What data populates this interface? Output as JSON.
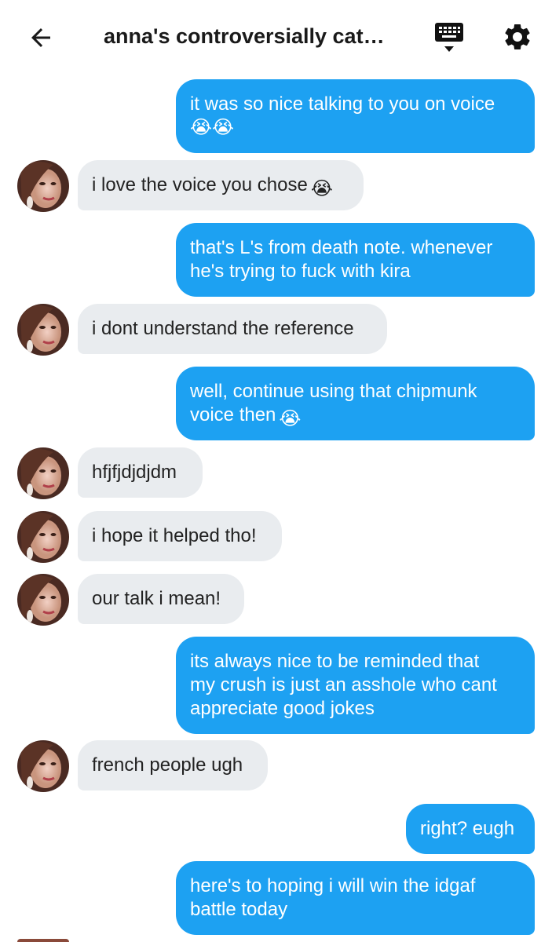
{
  "header": {
    "title": "anna's controversially cat…",
    "back_icon": "back-arrow-icon",
    "keyboard_icon": "keyboard-icon",
    "settings_icon": "gear-icon"
  },
  "colors": {
    "outgoing_bubble": "#1da1f2",
    "incoming_bubble": "#e9ecef",
    "outgoing_text": "#ffffff",
    "incoming_text": "#222222"
  },
  "messages": [
    {
      "side": "out",
      "lines": [
        "it was so nice talking to you on voice"
      ],
      "emoji_line": "😭😭"
    },
    {
      "side": "in",
      "lines": [
        "i love the voice you chose"
      ],
      "emoji": "😭"
    },
    {
      "side": "out",
      "lines": [
        "that's L's from death note. whenever",
        "he's trying to fuck with kira"
      ]
    },
    {
      "side": "in",
      "lines": [
        "i dont understand the reference"
      ]
    },
    {
      "side": "out",
      "lines": [
        "well, continue using that chipmunk",
        "voice then"
      ],
      "emoji": "😭"
    },
    {
      "side": "in",
      "lines": [
        "hfjfjdjdjdm"
      ]
    },
    {
      "side": "in",
      "lines": [
        "i hope it helped tho!"
      ]
    },
    {
      "side": "in",
      "lines": [
        "our talk i mean!"
      ]
    },
    {
      "side": "out",
      "lines": [
        "its always nice to be reminded that",
        "my crush is just an asshole who cant",
        "appreciate good jokes"
      ]
    },
    {
      "side": "in",
      "lines": [
        "french people ugh"
      ]
    },
    {
      "side": "out",
      "lines": [
        "right? eugh"
      ]
    },
    {
      "side": "out",
      "lines": [
        "here's to hoping i will win the idgaf",
        "battle today"
      ]
    }
  ]
}
